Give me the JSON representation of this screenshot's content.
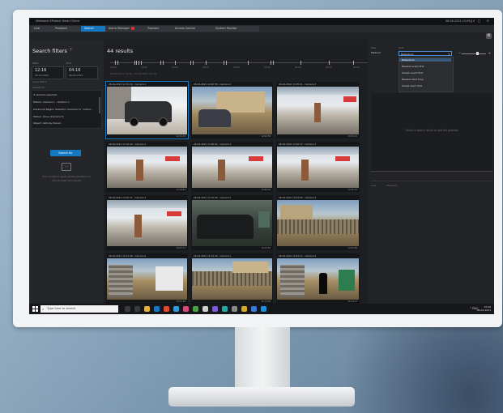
{
  "app": {
    "title": "Milestone XProtect Smart Client",
    "titlebar_right": "06-04-2021 15:09:14",
    "tabs": [
      "Live",
      "Playback",
      "Search",
      "Alarm Manager",
      "Transact",
      "Access Control",
      "System Monitor"
    ],
    "active_tab": "Search"
  },
  "filters": {
    "title": "Search filters",
    "help": "?",
    "start_label": "Start",
    "end_label": "End",
    "start_time": "12:16",
    "start_date": "06-04-2021",
    "end_time": "04:16",
    "end_date": "06-04-2021",
    "clear_label": "Clear filters",
    "sources_header": "Search for",
    "source_items": [
      "4 cameras selected",
      "Motion: Camera 1 - Outdoor 1",
      "Advanced Region Selection (Camera 3) - Indoor...",
      "Motion: Zone (Camera 5)",
      "Object: Vehicle, Person"
    ],
    "search_button": "Search for",
    "hint": "Find results to apply additional filters to narrow down the results"
  },
  "results": {
    "count_label": "44 results",
    "timeline_labels": [
      "12:00",
      "14:00",
      "16:00",
      "18:00",
      "20:00",
      "22:00",
      "00:00",
      "02:00",
      "04:00"
    ],
    "timeline_range": "06-04-2021 12:16 - 07-04-2021 04:16",
    "thumbnails": [
      {
        "caption": "06-04-2021 12:31:10 - Camera 1",
        "time": "12:31:10",
        "scene": "car-parking",
        "selected": true
      },
      {
        "caption": "06-04-2021 12:42:58 - Camera 2",
        "time": "12:42:58",
        "scene": "yard-car"
      },
      {
        "caption": "06-04-2021 13:05:21 - Camera 3",
        "time": "13:05:21",
        "scene": "indoor"
      },
      {
        "caption": "06-04-2021 13:18:44 - Camera 3",
        "time": "13:18:44",
        "scene": "indoor-door"
      },
      {
        "caption": "06-04-2021 13:26:02 - Camera 3",
        "time": "13:26:02",
        "scene": "indoor-door"
      },
      {
        "caption": "06-04-2021 13:40:37 - Camera 3",
        "time": "13:40:37",
        "scene": "indoor-door"
      },
      {
        "caption": "06-04-2021 14:02:11 - Camera 4",
        "time": "14:02:11",
        "scene": "indoor-door"
      },
      {
        "caption": "06-04-2021 14:15:59 - Camera 5",
        "time": "14:15:59",
        "scene": "night-car"
      },
      {
        "caption": "06-04-2021 14:33:06 - Camera 2",
        "time": "14:33:06",
        "scene": "yard-fence"
      },
      {
        "caption": "06-04-2021 15:01:48 - Camera 6",
        "time": "15:01:48",
        "scene": "truck"
      },
      {
        "caption": "06-04-2021 15:12:30 - Camera 2",
        "time": "15:12:30",
        "scene": "yard-fence"
      },
      {
        "caption": "06-04-2021 15:24:17 - Camera 6",
        "time": "15:24:17",
        "scene": "person"
      }
    ]
  },
  "preview": {
    "sort_label": "Sort",
    "sort_value": "Relevance",
    "sort_options": [
      "Relevance",
      "Newest event first",
      "Oldest event first",
      "Newest start time",
      "Oldest start time"
    ],
    "sort_selected": "Relevance",
    "layout_label": "Size",
    "layout_value": "Medium",
    "zoom_minus": "−",
    "zoom_plus": "+",
    "empty_message": "Select a search result to see the preview",
    "footer_items": [
      "Live",
      "Playback"
    ]
  },
  "taskbar": {
    "search_placeholder": "Type here to search",
    "tray": "^ ENG",
    "time": "15:09",
    "date": "06-04-2021"
  },
  "colors": {
    "accent": "#1778c2",
    "alarm_badge": "#d33333"
  }
}
